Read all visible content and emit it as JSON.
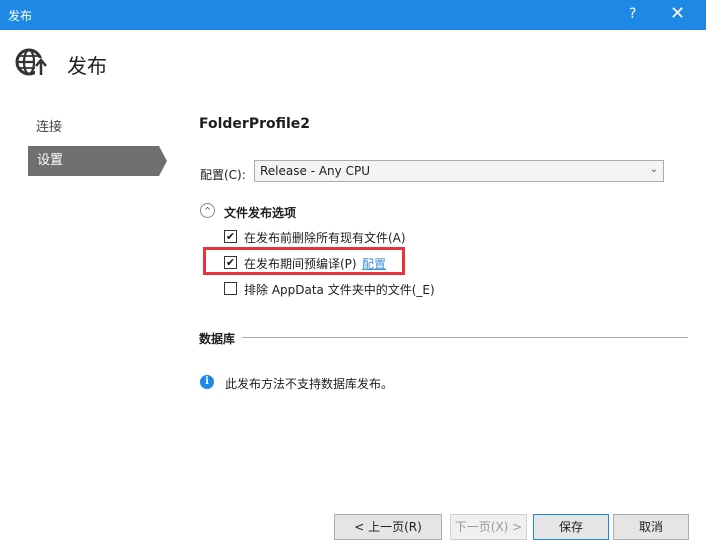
{
  "window": {
    "title": "发布",
    "help_label": "?",
    "close_label": "✕"
  },
  "header": {
    "title": "发布",
    "icon": "globe-publish-icon"
  },
  "sidebar": {
    "items": [
      {
        "label": "连接",
        "active": false
      },
      {
        "label": "设置",
        "active": true
      }
    ]
  },
  "settings": {
    "profile_name": "FolderProfile2",
    "config_label": "配置(C):",
    "config_value": "Release - Any CPU",
    "file_options_title": "文件发布选项",
    "options": [
      {
        "label": "在发布前删除所有现有文件(A)",
        "checked": true
      },
      {
        "label": "在发布期间预编译(P)",
        "checked": true,
        "link": "配置"
      },
      {
        "label": "排除 AppData 文件夹中的文件(_E)",
        "checked": false
      }
    ],
    "highlight_color": "#e8333a"
  },
  "database": {
    "title": "数据库",
    "info_text": "此发布方法不支持数据库发布。"
  },
  "footer": {
    "prev_label": "< 上一页(R)",
    "next_label": "下一页(X) >",
    "save_label": "保存",
    "cancel_label": "取消"
  },
  "colors": {
    "accent": "#1e88e5",
    "sidebar_active": "#707070"
  }
}
